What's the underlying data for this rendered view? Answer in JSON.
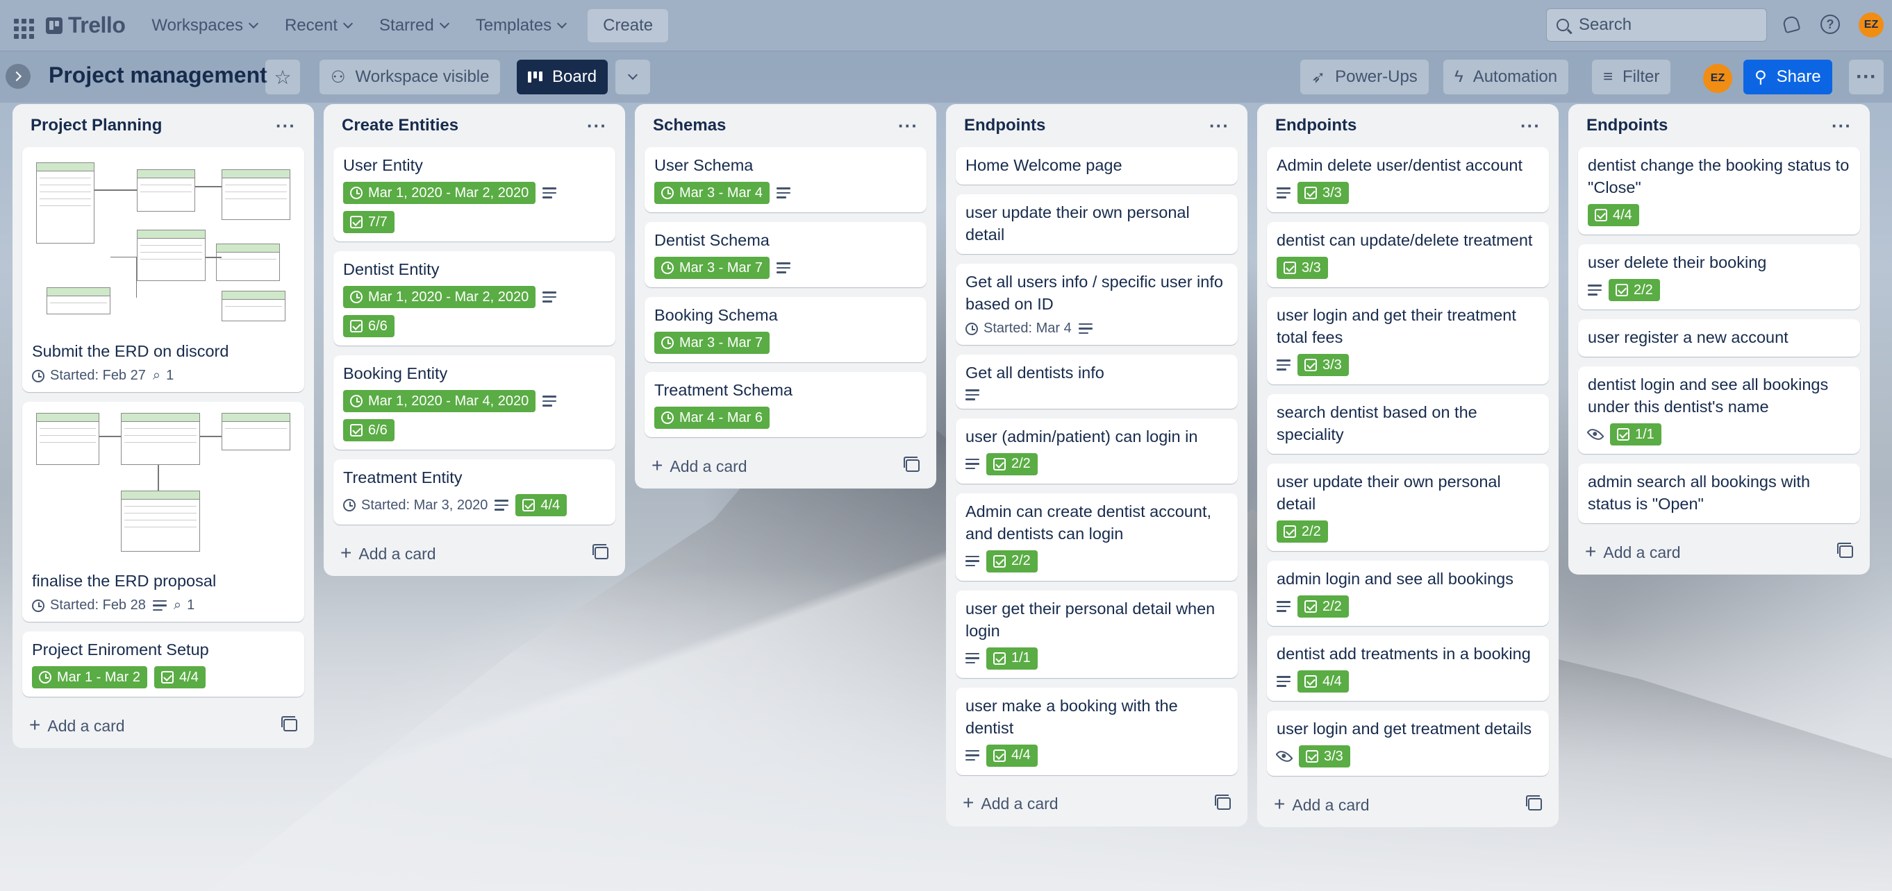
{
  "header": {
    "logo": "Trello",
    "nav": [
      "Workspaces",
      "Recent",
      "Starred",
      "Templates"
    ],
    "create": "Create",
    "search_placeholder": "Search",
    "avatar_initials": "EZ"
  },
  "board": {
    "title": "Project management",
    "visibility": "Workspace visible",
    "view": "Board",
    "powerups": "Power-Ups",
    "automation": "Automation",
    "filter": "Filter",
    "share": "Share",
    "avatar_initials": "EZ"
  },
  "add_card": "Add a card",
  "lists": [
    {
      "title": "Project Planning",
      "cards": [
        {
          "title": "Submit the ERD on discord",
          "started": "Started: Feb 27",
          "attachments": "1"
        },
        {
          "title": "finalise the ERD proposal",
          "started": "Started: Feb 28",
          "attachments": "1"
        },
        {
          "title": "Project Eniroment Setup",
          "dates": "Mar 1 - Mar 2",
          "checklist": "4/4"
        }
      ]
    },
    {
      "title": "Create Entities",
      "cards": [
        {
          "title": "User Entity",
          "dates": "Mar 1, 2020 - Mar 2, 2020",
          "checklist": "7/7"
        },
        {
          "title": "Dentist Entity",
          "dates": "Mar 1, 2020 - Mar 2, 2020",
          "checklist": "6/6"
        },
        {
          "title": "Booking Entity",
          "dates": "Mar 1, 2020 - Mar 4, 2020",
          "checklist": "6/6"
        },
        {
          "title": "Treatment Entity",
          "started": "Started: Mar 3, 2020",
          "checklist": "4/4"
        }
      ]
    },
    {
      "title": "Schemas",
      "cards": [
        {
          "title": "User Schema",
          "dates": "Mar 3 - Mar 4"
        },
        {
          "title": "Dentist Schema",
          "dates": "Mar 3 - Mar 7"
        },
        {
          "title": "Booking Schema",
          "dates": "Mar 3 - Mar 7"
        },
        {
          "title": "Treatment Schema",
          "dates": "Mar 4 - Mar 6"
        }
      ]
    },
    {
      "title": "Endpoints",
      "cards": [
        {
          "title": "Home Welcome page"
        },
        {
          "title": "user update their own personal detail"
        },
        {
          "title": "Get all users info / specific user info based on ID",
          "started": "Started: Mar 4"
        },
        {
          "title": "Get all dentists info"
        },
        {
          "title": "user (admin/patient) can login in",
          "checklist": "2/2"
        },
        {
          "title": "Admin can create dentist account, and dentists can login",
          "checklist": "2/2"
        },
        {
          "title": "user get their personal detail when login",
          "checklist": "1/1"
        },
        {
          "title": "user make a booking with the dentist",
          "checklist": "4/4"
        }
      ]
    },
    {
      "title": "Endpoints",
      "cards": [
        {
          "title": "Admin delete user/dentist account",
          "checklist": "3/3"
        },
        {
          "title": "dentist can update/delete treatment",
          "checklist": "3/3"
        },
        {
          "title": "user login and get their treatment total fees",
          "checklist": "3/3"
        },
        {
          "title": "search dentist based on the speciality"
        },
        {
          "title": "user update their own personal detail",
          "checklist": "2/2"
        },
        {
          "title": "admin login and see all bookings",
          "checklist": "2/2"
        },
        {
          "title": "dentist add treatments in a booking",
          "checklist": "4/4"
        },
        {
          "title": "user login and get treatment details",
          "checklist": "3/3"
        }
      ]
    },
    {
      "title": "Endpoints",
      "cards": [
        {
          "title": "dentist change the booking status to \"Close\"",
          "checklist": "4/4"
        },
        {
          "title": "user delete their booking",
          "checklist": "2/2"
        },
        {
          "title": "user register a new account"
        },
        {
          "title": "dentist login and see all bookings under this dentist's name",
          "checklist": "1/1"
        },
        {
          "title": "admin search all bookings with status is \"Open\""
        }
      ]
    }
  ]
}
